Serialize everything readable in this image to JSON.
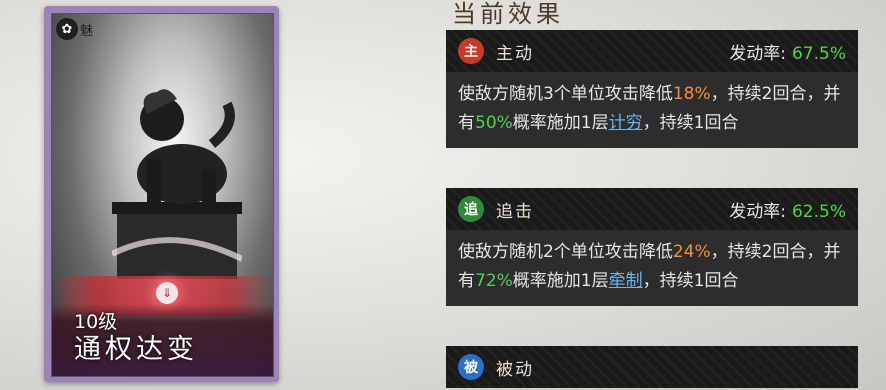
{
  "card": {
    "badge_icon": "✿",
    "badge_text": "魅",
    "level": "10级",
    "name": "通权达变",
    "center_icon": "⇓"
  },
  "effects_title": "当前效果",
  "effects": [
    {
      "icon": "主",
      "icon_color": "#c83a2a",
      "label": "主动",
      "rate_label": "发动率:",
      "rate_value": "67.5%",
      "desc": [
        {
          "t": "使敌方随机3个单位攻击降低",
          "c": ""
        },
        {
          "t": "18%",
          "c": "orange"
        },
        {
          "t": "，持续2回合，并有",
          "c": ""
        },
        {
          "t": "50%",
          "c": "green"
        },
        {
          "t": "概率施加1层",
          "c": ""
        },
        {
          "t": "计穷",
          "c": "link"
        },
        {
          "t": "，持续1回合",
          "c": ""
        }
      ]
    },
    {
      "icon": "追",
      "icon_color": "#2f8a3c",
      "label": "追击",
      "rate_label": "发动率:",
      "rate_value": "62.5%",
      "desc": [
        {
          "t": "使敌方随机2个单位攻击降低",
          "c": ""
        },
        {
          "t": "24%",
          "c": "orange"
        },
        {
          "t": "，持续2回合，并有",
          "c": ""
        },
        {
          "t": "72%",
          "c": "green"
        },
        {
          "t": "概率施加1层",
          "c": ""
        },
        {
          "t": "牵制",
          "c": "link"
        },
        {
          "t": "，持续1回合",
          "c": ""
        }
      ]
    },
    {
      "icon": "被",
      "icon_color": "#2a6fc8",
      "label": "被动",
      "rate_label": "",
      "rate_value": "",
      "desc": []
    }
  ]
}
